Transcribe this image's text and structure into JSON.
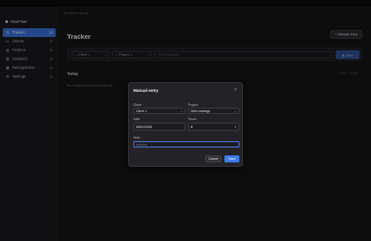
{
  "app": {
    "name": "RateFlow"
  },
  "sidebar": {
    "items": [
      {
        "label": "Tracker",
        "count": "(0)",
        "icon": "clock-icon"
      },
      {
        "label": "Clients",
        "count": "(0)",
        "icon": "folder-icon"
      },
      {
        "label": "Finance",
        "count": "(0)",
        "icon": "wallet-icon"
      },
      {
        "label": "Analytics",
        "count": "(0)",
        "icon": "chart-icon"
      },
      {
        "label": "Retrospective",
        "count": "(0)",
        "icon": "calendar-icon"
      },
      {
        "label": "Settings",
        "count": "(0)",
        "icon": "gear-icon"
      }
    ]
  },
  "main": {
    "hint": "No timer running",
    "title": "Tracker",
    "manual_button": "+ Manual entry",
    "filters": {
      "client": "— Client —",
      "project": "— Project —",
      "note_placeholder": "Note (optional)",
      "start": "▶ Start"
    },
    "day": {
      "label": "Today",
      "totals": "0.0 h · 0.00 €"
    },
    "empty_text": "No completed entries today yet."
  },
  "modal": {
    "title": "Manual entry",
    "close": "×",
    "client_label": "Client",
    "client_value": "Client 1",
    "project_label": "Project",
    "project_value": "Web redesign",
    "date_label": "Date",
    "date_value": "08/01/2026",
    "hours_label": "Hours",
    "hours_value": "8",
    "note_label": "Note",
    "note_placeholder": "optional",
    "cancel": "Cancel",
    "save": "Save"
  },
  "colors": {
    "accent": "#3d7be8",
    "background": "#141416",
    "sidebar": "#1a1a1d"
  }
}
